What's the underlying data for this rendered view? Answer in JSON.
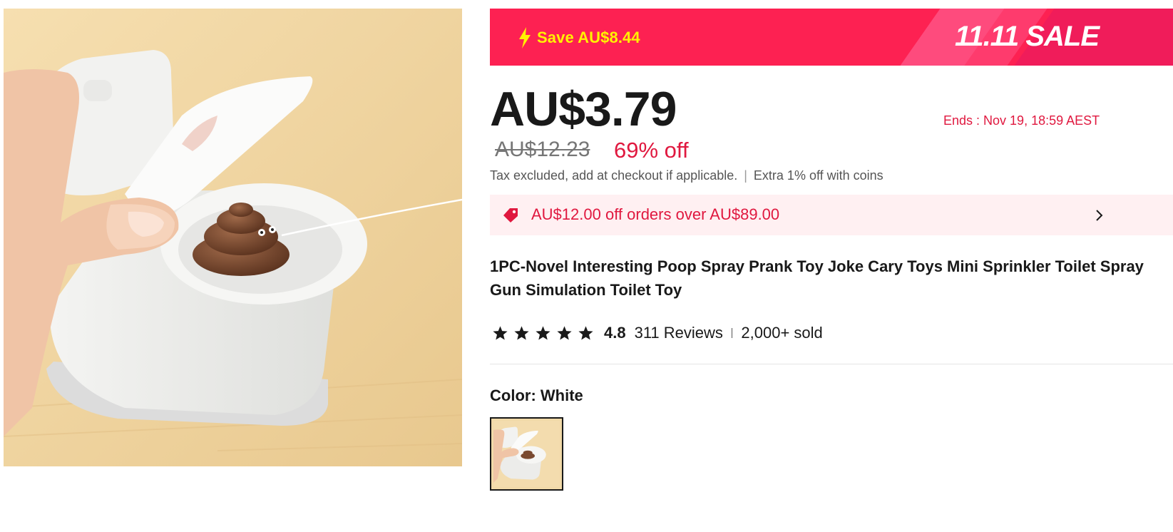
{
  "product_image": {
    "icon": "toilet-poop-toy-photo"
  },
  "sale_banner": {
    "save_text": "Save AU$8.44",
    "title": "11.11 SALE",
    "icon": "lightning-bolt-icon",
    "background": "#fd2152",
    "save_color": "#fff200"
  },
  "price": {
    "current": "AU$3.79",
    "original": "AU$12.23",
    "discount": "69% off",
    "ends": "Ends :  Nov 19, 18:59 AEST"
  },
  "tax": {
    "text": "Tax excluded, add at checkout if applicable.",
    "coins": "Extra 1% off with coins"
  },
  "coupon": {
    "text": "AU$12.00 off orders over AU$89.00",
    "icon": "tag-icon",
    "accent": "#e0183f"
  },
  "product": {
    "title": "1PC-Novel Interesting Poop Spray Prank Toy Joke Cary Toys Mini Sprinkler Toilet Spray Gun Simulation Toilet Toy"
  },
  "rating": {
    "stars": 5,
    "value": "4.8",
    "reviews": "311 Reviews",
    "sold": "2,000+ sold"
  },
  "color": {
    "label": "Color: White"
  }
}
